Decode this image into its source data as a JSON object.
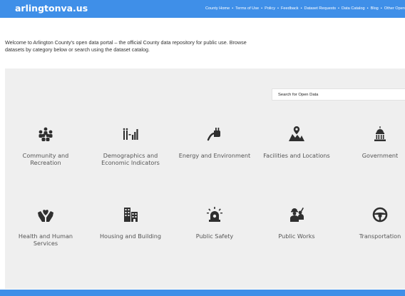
{
  "header": {
    "logo": "arlingtonva.us",
    "nav": [
      "County Home",
      "Terms of Use",
      "Policy",
      "Feedback",
      "Dataset Requests",
      "Data Catalog",
      "Blog",
      "Other Open"
    ],
    "separator": "•"
  },
  "intro": {
    "text": "Welcome to Arlington County's open data portal – the official County data repository for public use. Browse datasets by category below or search using the dataset catalog."
  },
  "search": {
    "placeholder": "Search for Open Data"
  },
  "categories": [
    {
      "label": "Community and Recreation",
      "icon": "people-group-icon"
    },
    {
      "label": "Demographics and Economic Indicators",
      "icon": "demographics-chart-icon"
    },
    {
      "label": "Energy and Environment",
      "icon": "plug-icon"
    },
    {
      "label": "Facilities and Locations",
      "icon": "map-pin-icon"
    },
    {
      "label": "Government",
      "icon": "capitol-building-icon"
    },
    {
      "label": "Health and Human Services",
      "icon": "hands-heart-icon"
    },
    {
      "label": "Housing and Building",
      "icon": "buildings-icon"
    },
    {
      "label": "Public Safety",
      "icon": "siren-icon"
    },
    {
      "label": "Public Works",
      "icon": "workers-icon"
    },
    {
      "label": "Transportation",
      "icon": "steering-wheel-icon"
    }
  ],
  "colors": {
    "brand_blue": "#3f8fe8",
    "panel_gray": "#efefef",
    "icon_dark": "#2f2f2f"
  }
}
